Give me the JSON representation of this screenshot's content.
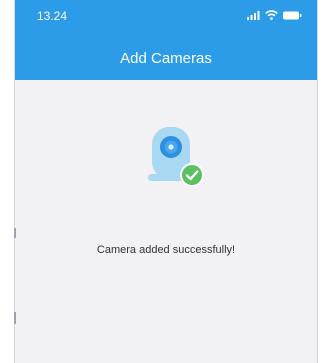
{
  "status_bar": {
    "time": "13.24",
    "icons": [
      "cellular-signal-icon",
      "wifi-icon",
      "battery-icon"
    ]
  },
  "nav": {
    "title": "Add Cameras"
  },
  "content": {
    "illustration_icon": "camera-added-success-icon",
    "message": "Camera added successfully!"
  },
  "colors": {
    "header": "#2d9ce8",
    "background": "#f2f2f4",
    "camera_body": "#a9d8f2",
    "check_badge": "#5cbf60"
  }
}
